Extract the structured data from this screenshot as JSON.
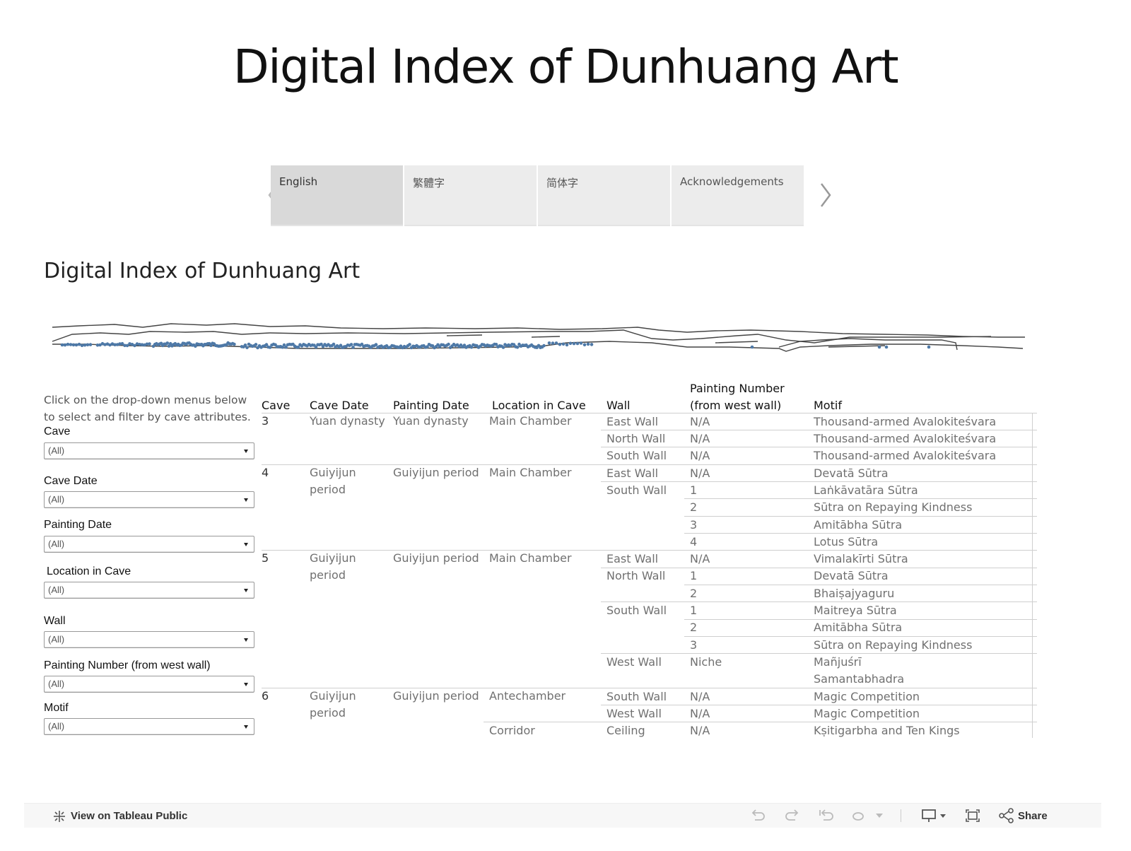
{
  "header": {
    "title": "Digital Index of Dunhuang Art"
  },
  "tabs": [
    {
      "label": "English",
      "active": true
    },
    {
      "label": "繁體字",
      "active": false
    },
    {
      "label": "简体字",
      "active": false
    },
    {
      "label": "Acknowledgements",
      "active": false
    }
  ],
  "dashboard": {
    "title": "Digital Index of Dunhuang Art",
    "instructions": "Click on the drop-down menus below to select and filter by cave attributes."
  },
  "filters": [
    {
      "label": "Cave",
      "value": "(All)"
    },
    {
      "label": "Cave Date",
      "value": "(All)"
    },
    {
      "label": "Painting Date",
      "value": "(All)"
    },
    {
      "label": "Location in Cave",
      "value": "(All)"
    },
    {
      "label": "Wall",
      "value": "(All)"
    },
    {
      "label": "Painting Number (from west wall)",
      "value": "(All)"
    },
    {
      "label": "Motif",
      "value": "(All)"
    }
  ],
  "table": {
    "headers": {
      "cave": "Cave",
      "cave_date": "Cave Date",
      "painting_date": "Painting Date",
      "location": "Location in Cave",
      "wall": "Wall",
      "painting_number_1": "Painting Number",
      "painting_number_2": "(from west wall)",
      "motif": "Motif"
    },
    "caves": [
      {
        "cave": "3",
        "cave_date": "Yuan dynasty",
        "painting_date": "Yuan dynasty",
        "location": "Main Chamber"
      },
      {
        "cave": "4",
        "cave_date": "Guiyijun period",
        "painting_date": "Guiyijun period",
        "location": "Main Chamber"
      },
      {
        "cave": "5",
        "cave_date": "Guiyijun period",
        "painting_date": "Guiyijun period",
        "location": "Main Chamber"
      },
      {
        "cave": "6",
        "cave_date": "Guiyijun period",
        "painting_date": "Guiyijun period",
        "location": "Antechamber",
        "location2": "Corridor"
      }
    ],
    "walls": [
      "East Wall",
      "North Wall",
      "South Wall",
      "East Wall",
      "South Wall",
      "East Wall",
      "North Wall",
      "South Wall",
      "West Wall",
      "South Wall",
      "West Wall",
      "Ceiling"
    ],
    "rows": [
      {
        "num": "N/A",
        "motif": "Thousand-armed Avalokiteśvara"
      },
      {
        "num": "N/A",
        "motif": "Thousand-armed Avalokiteśvara"
      },
      {
        "num": "N/A",
        "motif": "Thousand-armed Avalokiteśvara"
      },
      {
        "num": "N/A",
        "motif": "Devatā Sūtra"
      },
      {
        "num": "1",
        "motif": "Laṅkāvatāra Sūtra"
      },
      {
        "num": "2",
        "motif": "Sūtra on Repaying Kindness"
      },
      {
        "num": "3",
        "motif": "Amitābha Sūtra"
      },
      {
        "num": "4",
        "motif": "Lotus Sūtra"
      },
      {
        "num": "N/A",
        "motif": "Vimalakīrti Sūtra"
      },
      {
        "num": "1",
        "motif": "Devatā Sūtra"
      },
      {
        "num": "2",
        "motif": "Bhaiṣajyaguru"
      },
      {
        "num": "1",
        "motif": "Maitreya Sūtra"
      },
      {
        "num": "2",
        "motif": "Amitābha Sūtra"
      },
      {
        "num": "3",
        "motif": "Sūtra on Repaying Kindness"
      },
      {
        "num": "Niche",
        "motif": "Mañjuśrī",
        "motif2": "Samantabhadra"
      },
      {
        "num": "N/A",
        "motif": "Magic Competition"
      },
      {
        "num": "N/A",
        "motif": "Magic Competition"
      },
      {
        "num": "N/A",
        "motif": "Kṣitigarbha and Ten Kings"
      }
    ]
  },
  "footer": {
    "view_link": "View on Tableau Public",
    "share_label": "Share",
    "icons": [
      "tableau-logo-icon",
      "undo-icon",
      "redo-icon",
      "revert-icon",
      "refresh-icon",
      "dropdown-icon",
      "download-icon",
      "fullscreen-icon",
      "share-icon"
    ]
  },
  "colors": {
    "dot": "#4e79a7",
    "outline": "#444444",
    "active_tab": "#d9d9d9",
    "tab": "#ececec"
  }
}
